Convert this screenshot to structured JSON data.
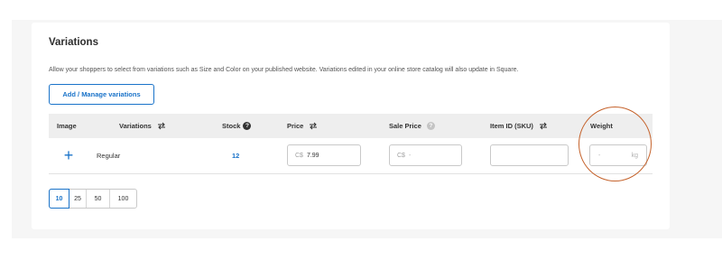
{
  "section": {
    "title": "Variations",
    "description": "Allow your shoppers to select from variations such as Size and Color on your published website. Variations edited in your online store catalog will also update in Square.",
    "manage_button": "Add / Manage variations"
  },
  "table": {
    "headers": {
      "image": "Image",
      "variations": "Variations",
      "stock": "Stock",
      "price": "Price",
      "sale_price": "Sale Price",
      "item_id": "Item ID (SKU)",
      "weight": "Weight"
    },
    "rows": [
      {
        "add_image": "+",
        "variation": "Regular",
        "stock": "12",
        "price_currency": "C$",
        "price": "7.99",
        "sale_currency": "C$",
        "sale_placeholder": "-",
        "item_id": "",
        "weight_placeholder": "-",
        "weight_unit": "kg"
      }
    ]
  },
  "pagination": {
    "options": [
      "10",
      "25",
      "50",
      "100"
    ],
    "selected": "10"
  },
  "colors": {
    "accent": "#1a73c9",
    "annotation": "#c5622b",
    "header_bg": "#eeeeee"
  },
  "icons": {
    "sort": "swap-arrows-icon",
    "help": "question-circle-icon",
    "add": "plus-icon"
  }
}
